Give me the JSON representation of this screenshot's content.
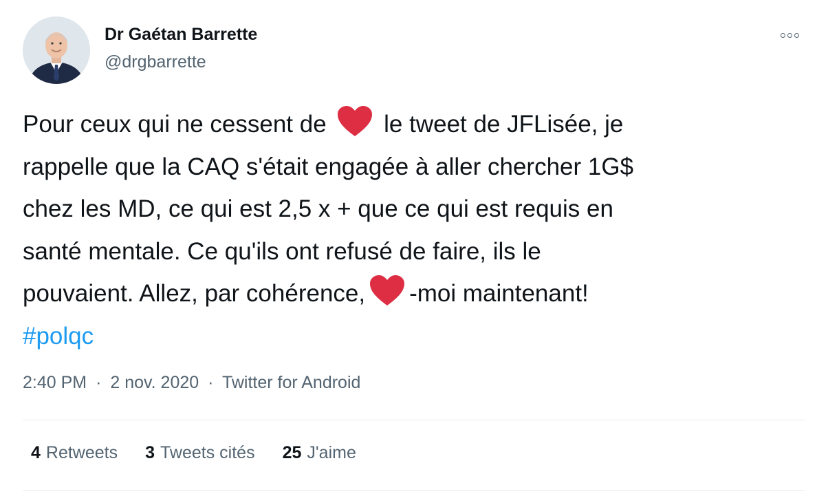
{
  "tweet": {
    "author": {
      "name": "Dr Gaétan Barrette",
      "handle": "@drgbarrette"
    },
    "text_lines": {
      "line1_before": "Pour ceux qui ne cessent de",
      "line1_after": "le tweet de JFLisée, je",
      "line2": "rappelle que la CAQ s'était engagée à aller chercher 1G$",
      "line3": "chez les MD, ce qui est 2,5 x + que ce qui est requis en",
      "line4": "santé mentale. Ce qu'ils ont refusé de faire, ils le",
      "line5_before": "pouvaient. Allez, par cohérence,",
      "line5_after": "-moi maintenant!",
      "hashtag": "#polqc"
    },
    "emoji": "heart-emoji",
    "meta": {
      "time": "2:40 PM",
      "separator": "·",
      "date": "2 nov. 2020",
      "source": "Twitter for Android"
    },
    "stats": {
      "retweets_count": "4",
      "retweets_label": "Retweets",
      "quotes_count": "3",
      "quotes_label": "Tweets cités",
      "likes_count": "25",
      "likes_label": "J'aime"
    }
  },
  "colors": {
    "text": "#0f1419",
    "secondary": "#536471",
    "link": "#1d9bf0",
    "heart": "#dd2e44",
    "divider": "#e6ecf0"
  }
}
